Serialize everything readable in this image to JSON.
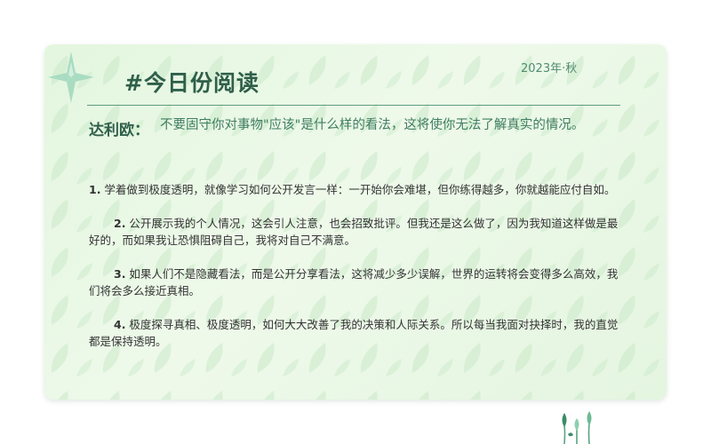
{
  "header": {
    "title": "#今日份阅读",
    "season": "2023年·秋"
  },
  "quote": {
    "author": "达利欧：",
    "text": "不要固守你对事物\"应该\"是什么样的看法，这将使你无法了解真实的情况。"
  },
  "points": [
    {
      "num": "1.",
      "text": " 学着做到极度透明，就像学习如何公开发言一样：一开始你会难堪，但你练得越多，你就越能应付自如。"
    },
    {
      "num": "2.",
      "text": " 公开展示我的个人情况，这会引人注意，也会招致批评。但我还是这么做了，因为我知道这样做是最好的，而如果我让恐惧阻碍自己，我将对自己不满意。"
    },
    {
      "num": "3.",
      "text": " 如果人们不是隐藏看法，而是公开分享看法，这将减少多少误解，世界的运转将会变得多么高效，我们将会多么接近真相。"
    },
    {
      "num": "4.",
      "text": " 极度探寻真相、极度透明，如何大大改善了我的决策和人际关系。所以每当我面对抉择时，我的直觉都是保持透明。"
    }
  ],
  "colors": {
    "card_bg": "#e8f7e4",
    "accent": "#2f5f4a",
    "quote_text": "#3f7d62",
    "leaf": "#a8dcc0"
  },
  "icons": {
    "corner": "four-point-star-icon",
    "bottom": "sprout-icon"
  }
}
